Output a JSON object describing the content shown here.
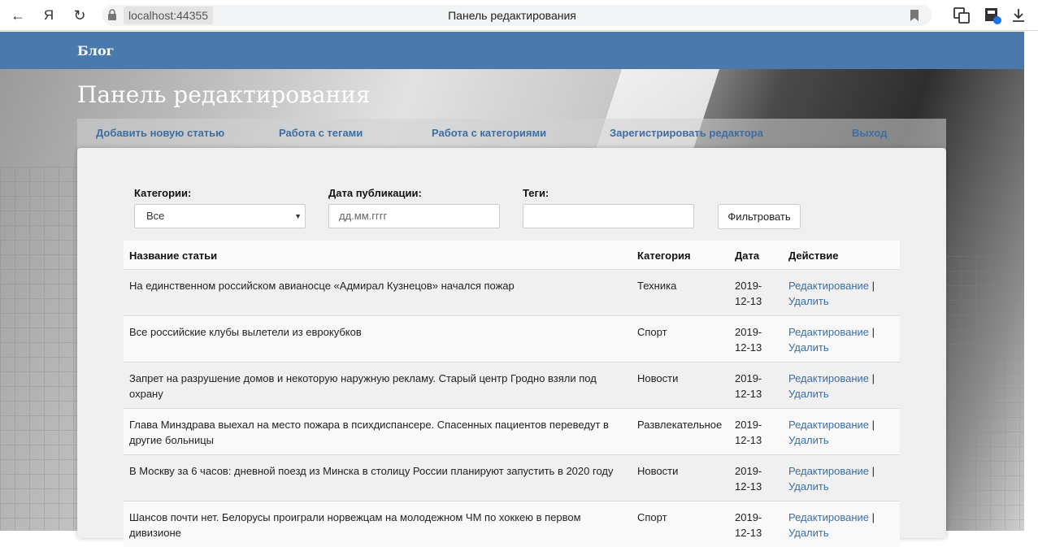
{
  "browser": {
    "address": "localhost:44355",
    "tab_title": "Панель редактирования",
    "yandex_label": "Я"
  },
  "navbar": {
    "brand": "Блог"
  },
  "page": {
    "title": "Панель редактирования"
  },
  "nav_links": {
    "add": "Добавить новую статью",
    "tags": "Работа с тегами",
    "categories": "Работа с категориями",
    "register": "Зарегистрировать редактора",
    "logout": "Выход"
  },
  "filters": {
    "category_label": "Категории:",
    "category_value": "Все",
    "date_label": "Дата публикации:",
    "date_placeholder": "дд.мм.гггг",
    "tags_label": "Теги:",
    "tags_value": "",
    "filter_button": "Фильтровать"
  },
  "table": {
    "headers": [
      "Название статьи",
      "Категория",
      "Дата",
      "Действие"
    ],
    "edit_label": "Редактирование",
    "separator": "|",
    "delete_label": "Удалить",
    "rows": [
      {
        "title": "На единственном российском авианосце «Адмирал Кузнецов» начался пожар",
        "category": "Техника",
        "date": "2019-12-13"
      },
      {
        "title": "Все российские клубы вылетели из еврокубков",
        "category": "Спорт",
        "date": "2019-12-13"
      },
      {
        "title": "Запрет на разрушение домов и некоторую наружную рекламу. Старый центр Гродно взяли под охрану",
        "category": "Новости",
        "date": "2019-12-13"
      },
      {
        "title": "Глава Минздрава выехал на место пожара в психдиспансере. Спасенных пациентов переведут в другие больницы",
        "category": "Развлекательное",
        "date": "2019-12-13"
      },
      {
        "title": "В Москву за 6 часов: дневной поезд из Минска в столицу России планируют запустить в 2020 году",
        "category": "Новости",
        "date": "2019-12-13"
      },
      {
        "title": "Шансов почти нет. Белорусы проиграли норвежцам на молодежном ЧМ по хоккею в первом дивизионе",
        "category": "Спорт",
        "date": "2019-12-13"
      }
    ]
  }
}
